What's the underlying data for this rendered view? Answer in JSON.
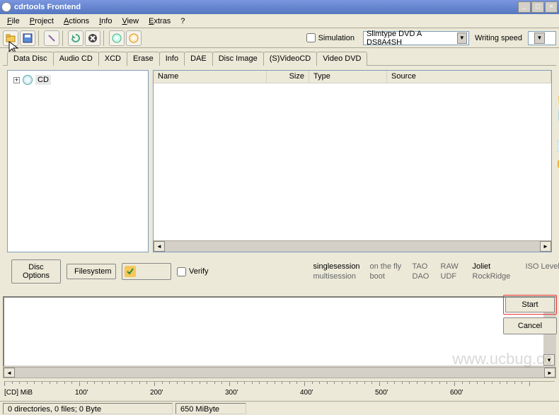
{
  "window": {
    "title": "cdrtools Frontend"
  },
  "menu": {
    "file": "File",
    "project": "Project",
    "actions": "Actions",
    "info": "Info",
    "view": "View",
    "extras": "Extras",
    "help": "?"
  },
  "toolbar": {
    "simulation": "Simulation",
    "device": "Slimtype DVD A  DS8A4SH",
    "writing_speed": "Writing speed",
    "speed_value": ""
  },
  "tabs": [
    "Data Disc",
    "Audio CD",
    "XCD",
    "Erase",
    "Info",
    "DAE",
    "Disc Image",
    "(S)VideoCD",
    "Video DVD"
  ],
  "tree": {
    "root": "CD"
  },
  "columns": {
    "name": "Name",
    "size": "Size",
    "type": "Type",
    "source": "Source"
  },
  "buttons": {
    "disc_options": "Disc Options",
    "filesystem": "Filesystem",
    "verify": "Verify",
    "start": "Start",
    "cancel": "Cancel"
  },
  "session": {
    "r1c1": "singlesession",
    "r1c2": "on the fly",
    "r1c3": "TAO",
    "r1c4": "RAW",
    "r1c5": "Joliet",
    "r1c6": "ISO Level",
    "r2c1": "multisession",
    "r2c2": "boot",
    "r2c3": "DAO",
    "r2c4": "UDF",
    "r2c5": "RockRidge",
    "r2c6": ""
  },
  "ruler": {
    "unit": "[CD] MiB",
    "ticks": [
      "100'",
      "200'",
      "300'",
      "400'",
      "500'",
      "600'"
    ]
  },
  "status": {
    "left": "0 directories, 0 files; 0 Byte",
    "mid": "650 MiByte"
  },
  "watermark": "www.ucbug.cc"
}
